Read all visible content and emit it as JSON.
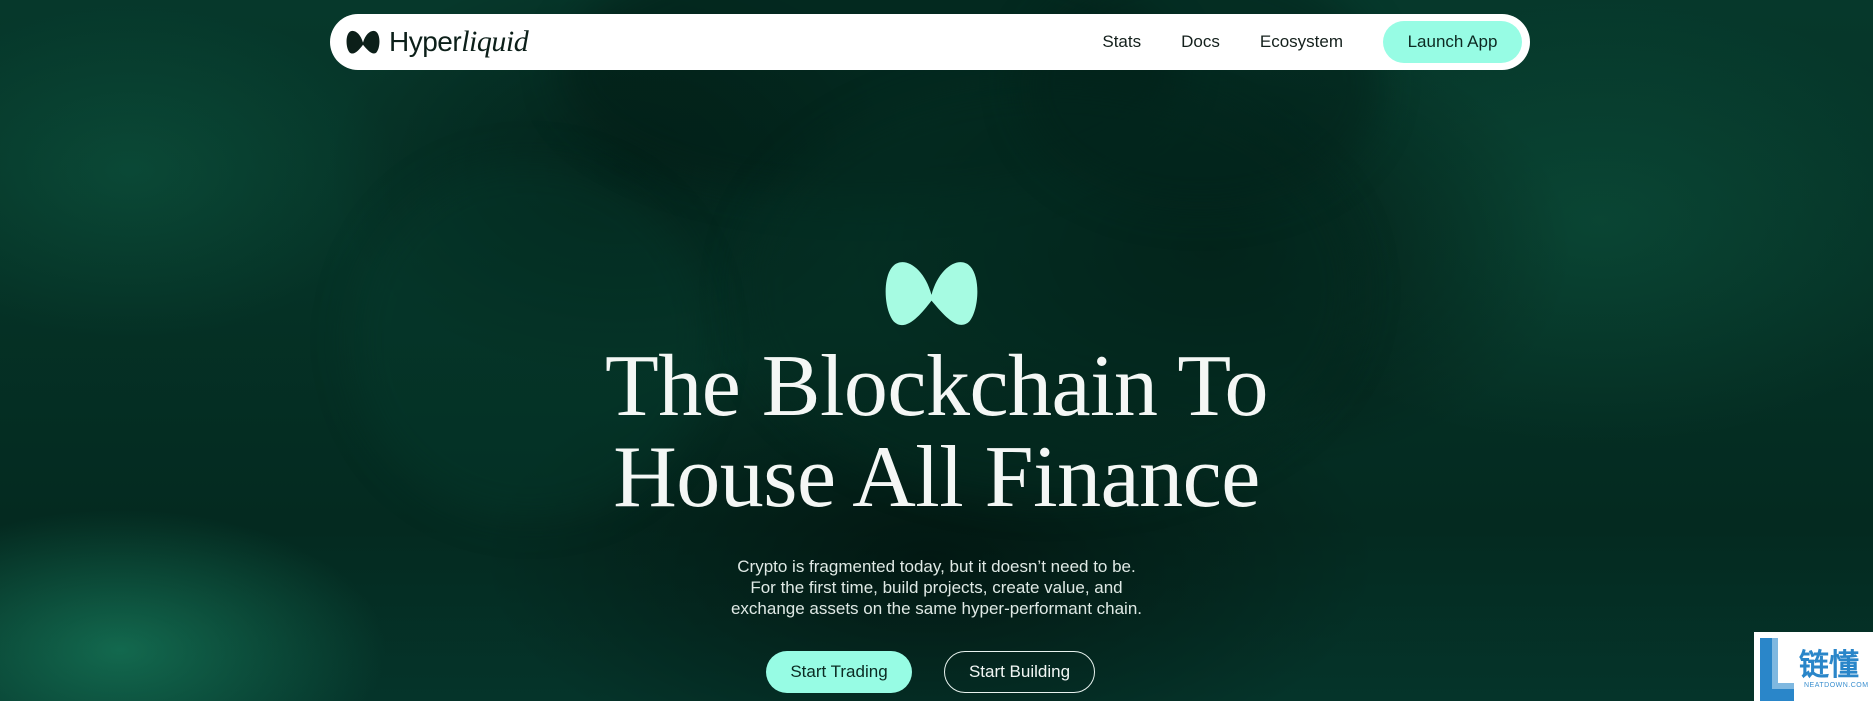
{
  "colors": {
    "accent": "#97fce4",
    "background": "#04241c",
    "navbar": "#ffffff"
  },
  "nav": {
    "logo_icon": "hyperliquid-logo-icon",
    "brand_regular": "Hyper",
    "brand_italic": "liquid",
    "links": [
      "Stats",
      "Docs",
      "Ecosystem"
    ],
    "cta_label": "Launch App"
  },
  "hero": {
    "icon": "hyperliquid-logo-icon",
    "title_line1": "The Blockchain To",
    "title_line2": "House All Finance",
    "sub_line1": "Crypto is fragmented today, but it doesn’t need to be.",
    "sub_line2": "For the first time, build projects, create value, and",
    "sub_line3": "exchange assets on the same hyper-performant chain.",
    "primary_button": "Start Trading",
    "secondary_button": "Start Building"
  },
  "watermark": {
    "cn_text": "链懂",
    "en_text": "NEATDOWN.COM"
  }
}
